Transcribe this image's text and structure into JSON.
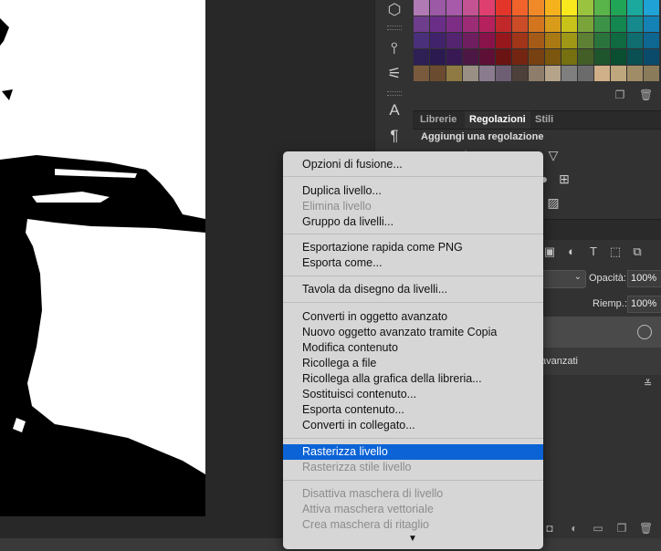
{
  "panels": {
    "tabs": [
      {
        "label": "Librerie",
        "active": false
      },
      {
        "label": "Regolazioni",
        "active": true
      },
      {
        "label": "Stili",
        "active": false
      }
    ],
    "adjustments_title": "Aggiungi una regolazione",
    "layers": {
      "opacity_label": "Opacità:",
      "opacity_value": "100%",
      "fill_label": "Riemp.:",
      "fill_value": "100%",
      "layer_name_fragment": "avanzati"
    }
  },
  "swatch_colors": [
    [
      "#b07ab5",
      "#9b59a6",
      "#a65aa9",
      "#c35392",
      "#df3f6f",
      "#e4352a",
      "#f1632a",
      "#f08a28",
      "#f6b21c",
      "#f9e81d",
      "#9ac43f",
      "#59b44a",
      "#20a456",
      "#1ba89d",
      "#1fa3d6"
    ],
    [
      "#6e3d8c",
      "#6a2d88",
      "#7d2d85",
      "#9c2c76",
      "#b5215c",
      "#c1282a",
      "#cb4c27",
      "#d3751f",
      "#d89b1a",
      "#c8c21a",
      "#7aa43a",
      "#3c9347",
      "#148650",
      "#15898b",
      "#1482b5"
    ],
    [
      "#4a2f7a",
      "#40236b",
      "#542470",
      "#6f1f5f",
      "#88134a",
      "#96181c",
      "#a03519",
      "#a55b18",
      "#a97913",
      "#9f9816",
      "#5d8034",
      "#2b733d",
      "#0f6a42",
      "#0f6c6f",
      "#0e6790"
    ],
    [
      "#2e1f55",
      "#2b1a4f",
      "#381953",
      "#4c1744",
      "#5e0f36",
      "#6a1313",
      "#732512",
      "#774112",
      "#7b560f",
      "#767010",
      "#435e27",
      "#1f552d",
      "#0a4e31",
      "#0a4f51",
      "#0a4b6b"
    ],
    [
      "#7a5a3c",
      "#6b4b2f",
      "#8e7a42",
      "#9a8f84",
      "#8a7b8f",
      "#6d5e74",
      "#4d3f3a",
      "#8f7d6b",
      "#b6a48a",
      "#7f7f7f",
      "#6b6b6b",
      "#d0b088",
      "#bfa77d",
      "#a08d67",
      "#8a7b5a"
    ]
  ],
  "context_menu": {
    "items": [
      {
        "label": "Opzioni di fusione...",
        "disabled": false
      },
      {
        "label": "Duplica livello...",
        "disabled": false
      },
      {
        "label": "Elimina livello",
        "disabled": true
      },
      {
        "label": "Gruppo da livelli...",
        "disabled": false
      },
      {
        "label": "Esportazione rapida come PNG",
        "disabled": false
      },
      {
        "label": "Esporta come...",
        "disabled": false
      },
      {
        "label": "Tavola da disegno da livelli...",
        "disabled": false
      },
      {
        "label": "Converti in oggetto avanzato",
        "disabled": false
      },
      {
        "label": "Nuovo oggetto avanzato tramite Copia",
        "disabled": false
      },
      {
        "label": "Modifica contenuto",
        "disabled": false
      },
      {
        "label": "Ricollega a file",
        "disabled": false
      },
      {
        "label": "Ricollega alla grafica della libreria...",
        "disabled": false
      },
      {
        "label": "Sostituisci contenuto...",
        "disabled": false
      },
      {
        "label": "Esporta contenuto...",
        "disabled": false
      },
      {
        "label": "Converti in collegato...",
        "disabled": false
      },
      {
        "label": "Rasterizza livello",
        "disabled": false,
        "selected": true
      },
      {
        "label": "Rasterizza stile livello",
        "disabled": true
      },
      {
        "label": "Disattiva maschera di livello",
        "disabled": true
      },
      {
        "label": "Attiva maschera vettoriale",
        "disabled": true
      },
      {
        "label": "Crea maschera di ritaglio",
        "disabled": true
      }
    ],
    "scroll_indicator": "▼"
  },
  "tools": [
    {
      "name": "3d-cube-icon",
      "glyph": "⬡"
    },
    {
      "name": "brush-presets-icon",
      "glyph": "⫯"
    },
    {
      "name": "sliders-icon",
      "glyph": "⚟"
    },
    {
      "name": "character-icon",
      "glyph": "A"
    },
    {
      "name": "paragraph-icon",
      "glyph": "¶"
    }
  ],
  "colors": {
    "menu_bg": "#d6d6d6",
    "menu_selected": "#0b63d6",
    "panel_bg": "#323232",
    "canvas_bg": "#282828"
  }
}
